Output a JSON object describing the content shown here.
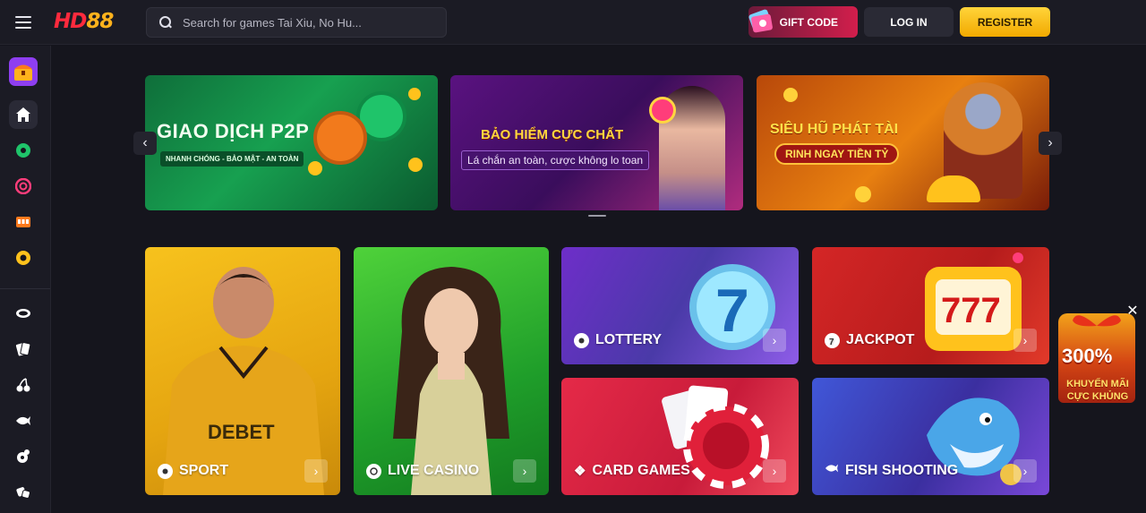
{
  "header": {
    "logo_part1": "HD",
    "logo_part2": "88",
    "search_placeholder": "Search for games Tai Xiu, No Hu...",
    "gift_code_label": "GIFT CODE",
    "login_label": "LOG IN",
    "register_label": "REGISTER"
  },
  "sidebar": {
    "items": [
      {
        "icon": "treasure-chest-icon"
      },
      {
        "icon": "home-icon"
      },
      {
        "icon": "soccer-ball-icon"
      },
      {
        "icon": "casino-chip-icon"
      },
      {
        "icon": "slot-machine-icon"
      },
      {
        "icon": "lottery-ball-icon"
      },
      {
        "icon": "poker-table-icon"
      },
      {
        "icon": "playing-cards-icon"
      },
      {
        "icon": "cherries-icon"
      },
      {
        "icon": "fish-icon"
      },
      {
        "icon": "cockfight-icon"
      },
      {
        "icon": "dice-icon"
      }
    ]
  },
  "banners": [
    {
      "title": "GIAO DỊCH P2P",
      "subtitle": "NHANH CHÓNG - BẢO MẬT - AN TOÀN"
    },
    {
      "title": "BẢO HIỂM CỰC CHẤT",
      "subtitle": "Lá chắn an toàn, cược không lo toan"
    },
    {
      "title": "SIÊU HŨ PHÁT TÀI",
      "subtitle": "RINH NGAY TIỀN TỶ"
    }
  ],
  "carousel": {
    "prev_icon": "chevron-left-icon",
    "next_icon": "chevron-right-icon"
  },
  "categories": {
    "sport": "SPORT",
    "live_casino": "LIVE CASINO",
    "lottery": "LOTTERY",
    "jackpot": "JACKPOT",
    "card_games": "CARD GAMES",
    "fish_shooting": "FISH SHOOTING"
  },
  "promo": {
    "percent": "300%",
    "line1": "KHUYẾN MÃI",
    "line2": "CỰC KHỦNG"
  },
  "colors": {
    "accent": "#ffc21c",
    "brand_red": "#ff2a3d",
    "gift": "#d21e4c",
    "background": "#15151d"
  }
}
